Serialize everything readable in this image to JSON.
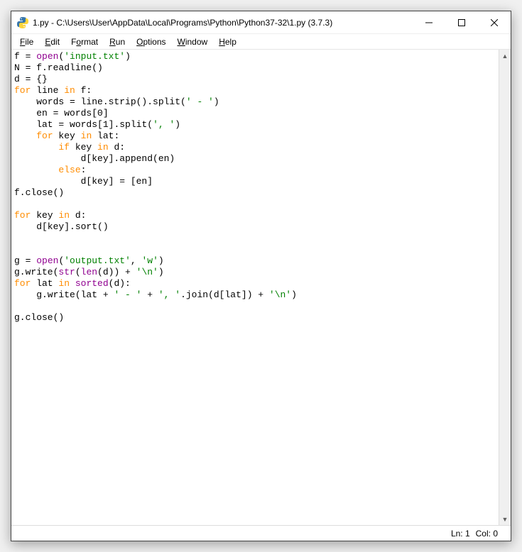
{
  "title": "1.py - C:\\Users\\User\\AppData\\Local\\Programs\\Python\\Python37-32\\1.py (3.7.3)",
  "menu": {
    "file": "File",
    "edit": "Edit",
    "format": "Format",
    "run": "Run",
    "options": "Options",
    "window": "Window",
    "help": "Help"
  },
  "status": {
    "ln": "Ln: 1",
    "col": "Col: 0"
  },
  "code": {
    "l1_f": "f = ",
    "l1_open": "open",
    "l1_paren1": "(",
    "l1_str": "'input.txt'",
    "l1_paren2": ")",
    "l2": "N = f.readline()",
    "l3": "d = {}",
    "l4_for": "for",
    "l4_mid": " line ",
    "l4_in": "in",
    "l4_end": " f:",
    "l5_pre": "    words = line.strip().split(",
    "l5_str": "' - '",
    "l5_post": ")",
    "l6_pre": "    en = words[",
    "l6_num": "0",
    "l6_post": "]",
    "l7_pre": "    lat = words[",
    "l7_num": "1",
    "l7_mid": "].split(",
    "l7_str": "', '",
    "l7_post": ")",
    "l8_sp": "    ",
    "l8_for": "for",
    "l8_mid": " key ",
    "l8_in": "in",
    "l8_end": " lat:",
    "l9_sp": "        ",
    "l9_if": "if",
    "l9_mid": " key ",
    "l9_in": "in",
    "l9_end": " d:",
    "l10": "            d[key].append(en)",
    "l11_sp": "        ",
    "l11_else": "else",
    "l11_end": ":",
    "l12": "            d[key] = [en]",
    "l13": "f.close()",
    "l15_for": "for",
    "l15_mid": " key ",
    "l15_in": "in",
    "l15_end": " d:",
    "l16": "    d[key].sort()",
    "l19_g": "g = ",
    "l19_open": "open",
    "l19_p1": "(",
    "l19_s1": "'output.txt'",
    "l19_c": ", ",
    "l19_s2": "'w'",
    "l19_p2": ")",
    "l20_pre": "g.write(",
    "l20_str": "str",
    "l20_p1": "(",
    "l20_len": "len",
    "l20_p2": "(d)) + ",
    "l20_nl": "'\\n'",
    "l20_p3": ")",
    "l21_for": "for",
    "l21_mid": " lat ",
    "l21_in": "in",
    "l21_sp": " ",
    "l21_sorted": "sorted",
    "l21_end": "(d):",
    "l22_pre": "    g.write(lat + ",
    "l22_s1": "' - '",
    "l22_m1": " + ",
    "l22_s2": "', '",
    "l22_m2": ".join(d[lat]) + ",
    "l22_s3": "'\\n'",
    "l22_p": ")",
    "l24": "g.close()"
  }
}
